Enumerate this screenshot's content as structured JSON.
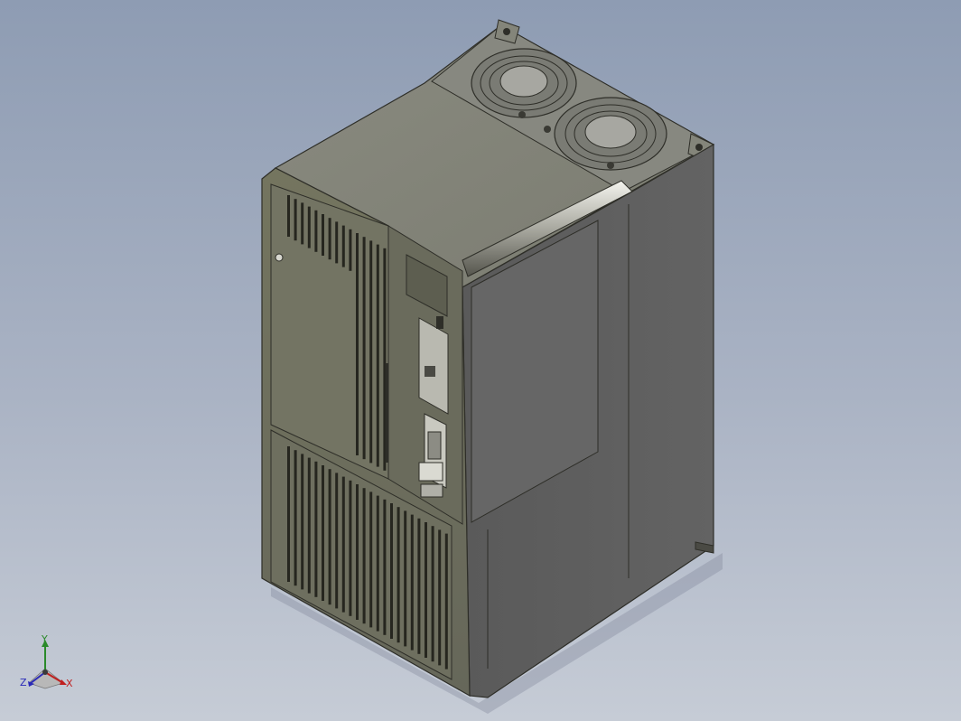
{
  "viewport": {
    "background_top": "#8e9cb3",
    "background_bottom": "#c6ccd6"
  },
  "model": {
    "description_name": "inverter-housing",
    "colors": {
      "top": "#84857a",
      "left": "#6f705f",
      "right": "#5e5e5e",
      "edge": "#2e2e28",
      "fan_grill": "#8c8c86"
    },
    "fan_count": 2
  },
  "triad": {
    "x_label": "X",
    "y_label": "Y",
    "z_label": "Z",
    "x_color": "#c02020",
    "y_color": "#2a8a2a",
    "z_color": "#2a2ab8"
  }
}
